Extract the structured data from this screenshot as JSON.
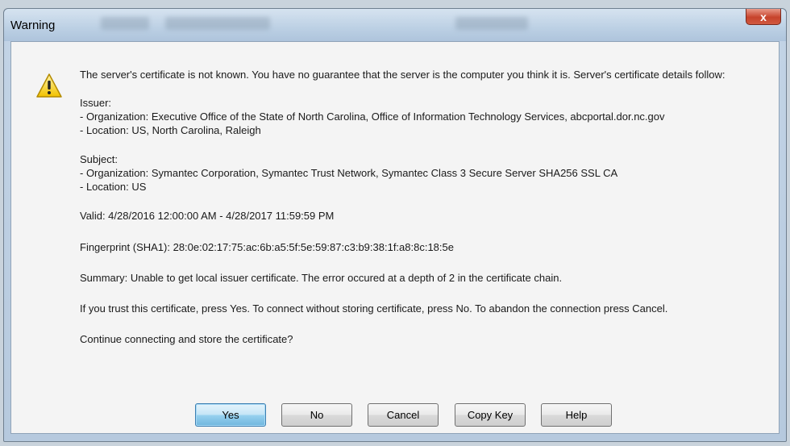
{
  "window": {
    "title": "Warning",
    "close_label": "x"
  },
  "icon": "warning-triangle-icon",
  "message": {
    "intro": "The server's certificate is not known. You have no guarantee that the server is the computer you think it is. Server's certificate details follow:",
    "issuer_heading": "Issuer:",
    "issuer_org": "- Organization: Executive Office of the State of North Carolina, Office of Information Technology Services, abcportal.dor.nc.gov",
    "issuer_location": "- Location: US, North Carolina, Raleigh",
    "subject_heading": "Subject:",
    "subject_org": "- Organization: Symantec Corporation, Symantec Trust Network, Symantec Class 3 Secure Server SHA256 SSL CA",
    "subject_location": "- Location: US",
    "valid": "Valid: 4/28/2016 12:00:00 AM - 4/28/2017 11:59:59 PM",
    "fingerprint": "Fingerprint (SHA1): 28:0e:02:17:75:ac:6b:a5:5f:5e:59:87:c3:b9:38:1f:a8:8c:18:5e",
    "summary": "Summary: Unable to get local issuer certificate. The error occured at a depth of 2 in the certificate chain.",
    "instructions": "If you trust this certificate, press Yes. To connect without storing certificate, press No. To abandon the connection press Cancel.",
    "question": "Continue connecting and store the certificate?"
  },
  "buttons": {
    "yes": "Yes",
    "no": "No",
    "cancel": "Cancel",
    "copy_key": "Copy Key",
    "help": "Help"
  },
  "colors": {
    "titlebar": "#bcd0e4",
    "close_button": "#c7432c",
    "default_button": "#98d1ef",
    "warning_icon": "#f2c200"
  }
}
